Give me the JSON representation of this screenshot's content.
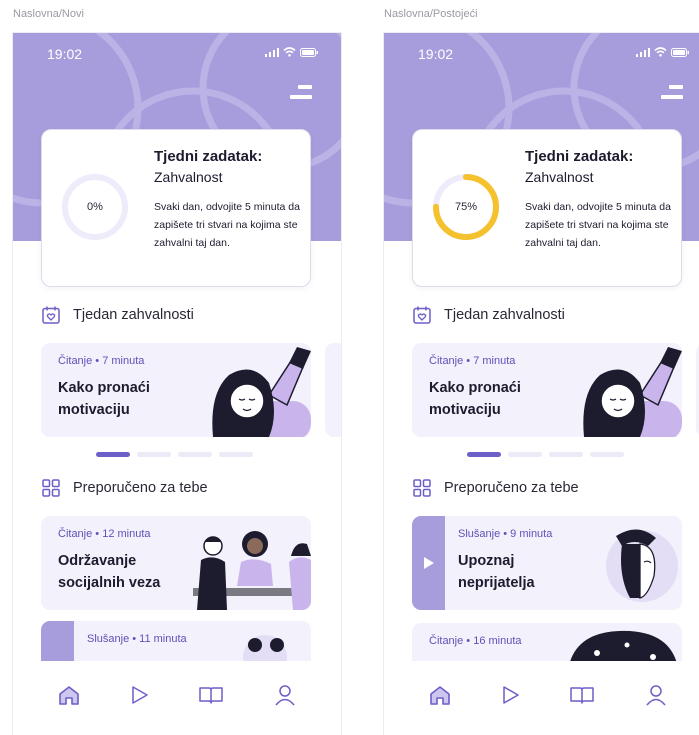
{
  "frames": [
    {
      "label": "Naslovna/Novi",
      "time": "19:02",
      "task": {
        "title": "Tjedni zadatak:",
        "subtitle": "Zahvalnost",
        "description": "Svaki dan, odvojite 5 minuta da zapišete tri stvari na kojima ste zahvalni taj dan.",
        "progress_label": "0%",
        "progress": 0
      },
      "section_week": "Tjedan zahvalnosti",
      "featured": {
        "meta": "Čitanje • 7 minuta",
        "title": "Kako pronaći motivaciju"
      },
      "section_recommended": "Preporučeno za tebe",
      "recommended": [
        {
          "meta": "Čitanje • 12 minuta",
          "title": "Održavanje socijalnih veza",
          "kind": "reading"
        },
        {
          "meta": "Slušanje • 11 minuta",
          "title": "",
          "kind": "audio"
        }
      ],
      "tabs": [
        "home-icon",
        "play-icon",
        "book-icon",
        "profile-icon"
      ]
    },
    {
      "label": "Naslovna/Postojeći",
      "time": "19:02",
      "task": {
        "title": "Tjedni zadatak:",
        "subtitle": "Zahvalnost",
        "description": "Svaki dan, odvojite 5 minuta da zapišete tri stvari na kojima ste zahvalni taj dan.",
        "progress_label": "75%",
        "progress": 0.75
      },
      "section_week": "Tjedan zahvalnosti",
      "featured": {
        "meta": "Čitanje • 7 minuta",
        "title": "Kako pronaći motivaciju"
      },
      "section_recommended": "Preporučeno za tebe",
      "recommended": [
        {
          "meta": "Slušanje • 9 minuta",
          "title": "Upoznaj neprijatelja",
          "kind": "audio"
        },
        {
          "meta": "Čitanje • 16 minuta",
          "title": "",
          "kind": "reading"
        }
      ],
      "tabs": [
        "home-icon",
        "play-icon",
        "book-icon",
        "profile-icon"
      ]
    }
  ],
  "colors": {
    "primary": "#a79ddc",
    "accent": "#6c5fc7",
    "progress": "#f5c22e",
    "card_bg": "#f3f1fb",
    "track": "#eeebfa"
  }
}
